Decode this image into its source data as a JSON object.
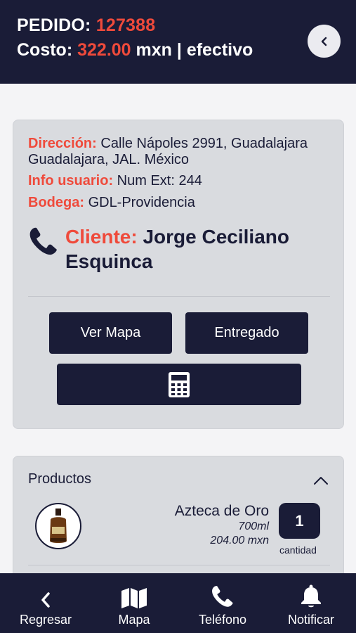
{
  "header": {
    "order_label": "PEDIDO:",
    "order_number": "127388",
    "cost_label": "Costo:",
    "cost_value": "322.00",
    "cost_suffix": "mxn | efectivo"
  },
  "details": {
    "address_label": "Dirección:",
    "address_value": "Calle Nápoles 2991, Guadalajara Guadalajara, JAL. México",
    "user_info_label": "Info usuario:",
    "user_info_value": "Num Ext: 244",
    "warehouse_label": "Bodega:",
    "warehouse_value": "GDL-Providencia",
    "client_label": "Cliente:",
    "client_name": "Jorge Ceciliano Esquinca"
  },
  "actions": {
    "map_label": "Ver Mapa",
    "delivered_label": "Entregado",
    "calculator_icon": "calculator-icon"
  },
  "products": {
    "title": "Productos",
    "items": [
      {
        "name": "Azteca de Oro",
        "size": "700ml",
        "price": "204.00 mxn",
        "quantity": "1",
        "quantity_label": "cantidad"
      }
    ]
  },
  "nav": {
    "back": "Regresar",
    "map": "Mapa",
    "phone": "Teléfono",
    "notify": "Notificar"
  },
  "colors": {
    "primary": "#1a1c37",
    "accent": "#ef4a3b",
    "card": "#d9dbdf"
  }
}
